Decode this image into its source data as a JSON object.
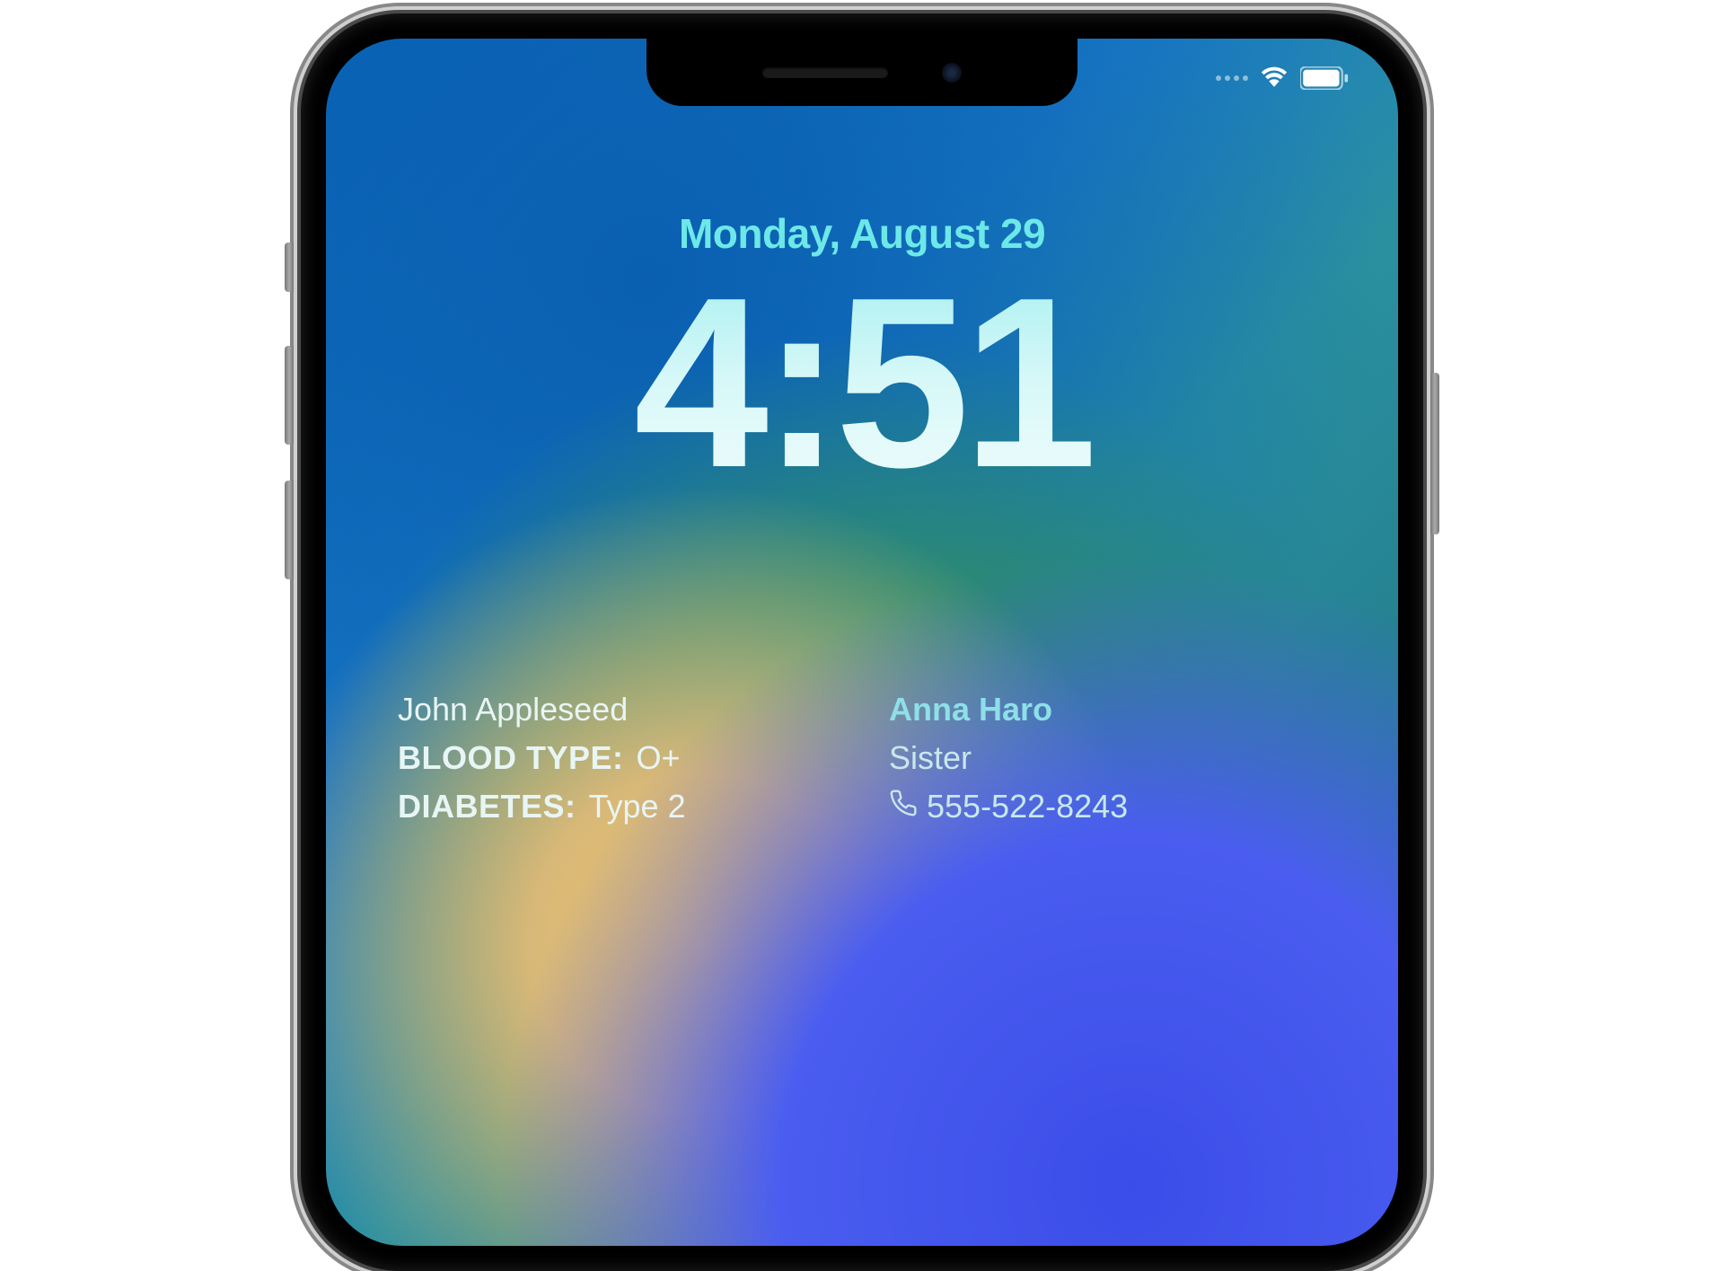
{
  "status": {
    "wifi": true,
    "battery_full": true
  },
  "lockscreen": {
    "date": "Monday, August 29",
    "time": "4:51"
  },
  "medical": {
    "owner_name": "John Appleseed",
    "blood_type_label": "BLOOD TYPE:",
    "blood_type_value": "O+",
    "condition_label": "DIABETES:",
    "condition_value": "Type 2"
  },
  "emergency_contact": {
    "name": "Anna Haro",
    "relationship": "Sister",
    "phone": "555-522-8243"
  }
}
